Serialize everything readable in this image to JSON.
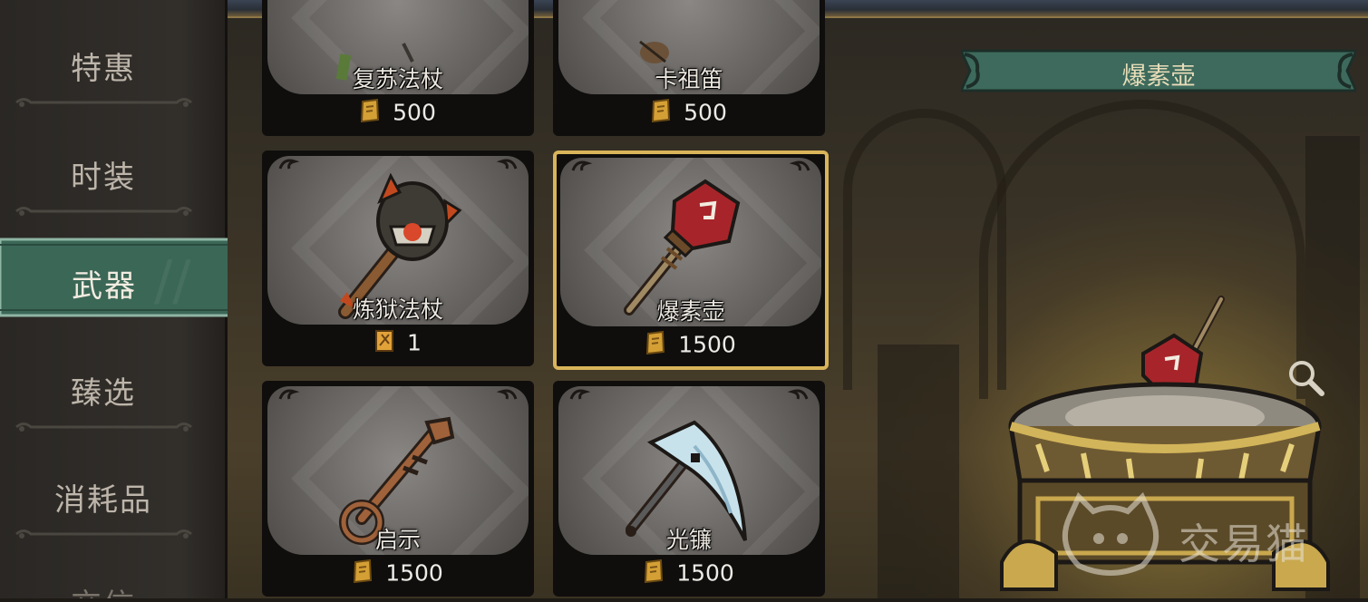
{
  "sidebar": {
    "items": [
      {
        "label": "特惠"
      },
      {
        "label": "时装"
      },
      {
        "label": "武器",
        "active": true
      },
      {
        "label": "臻选"
      },
      {
        "label": "消耗品"
      },
      {
        "label": "交信"
      }
    ]
  },
  "shop": {
    "items": [
      {
        "name": "复苏法杖",
        "price": "500",
        "currency": "gold-coin"
      },
      {
        "name": "卡祖笛",
        "price": "500",
        "currency": "gold-coin"
      },
      {
        "name": "炼狱法杖",
        "price": "1",
        "currency": "weapon-ticket"
      },
      {
        "name": "爆素壶",
        "price": "1500",
        "currency": "gold-coin",
        "selected": true
      },
      {
        "name": "启示",
        "price": "1500",
        "currency": "gold-coin"
      },
      {
        "name": "光镰",
        "price": "1500",
        "currency": "gold-coin"
      }
    ]
  },
  "preview": {
    "title": "爆素壶",
    "zoom_icon": "magnifier-icon"
  },
  "watermark": {
    "text": "交易猫"
  },
  "colors": {
    "accent_green": "#3d6a5c",
    "selected_border": "#d9b45a",
    "coin_gold": "#d4a035"
  }
}
